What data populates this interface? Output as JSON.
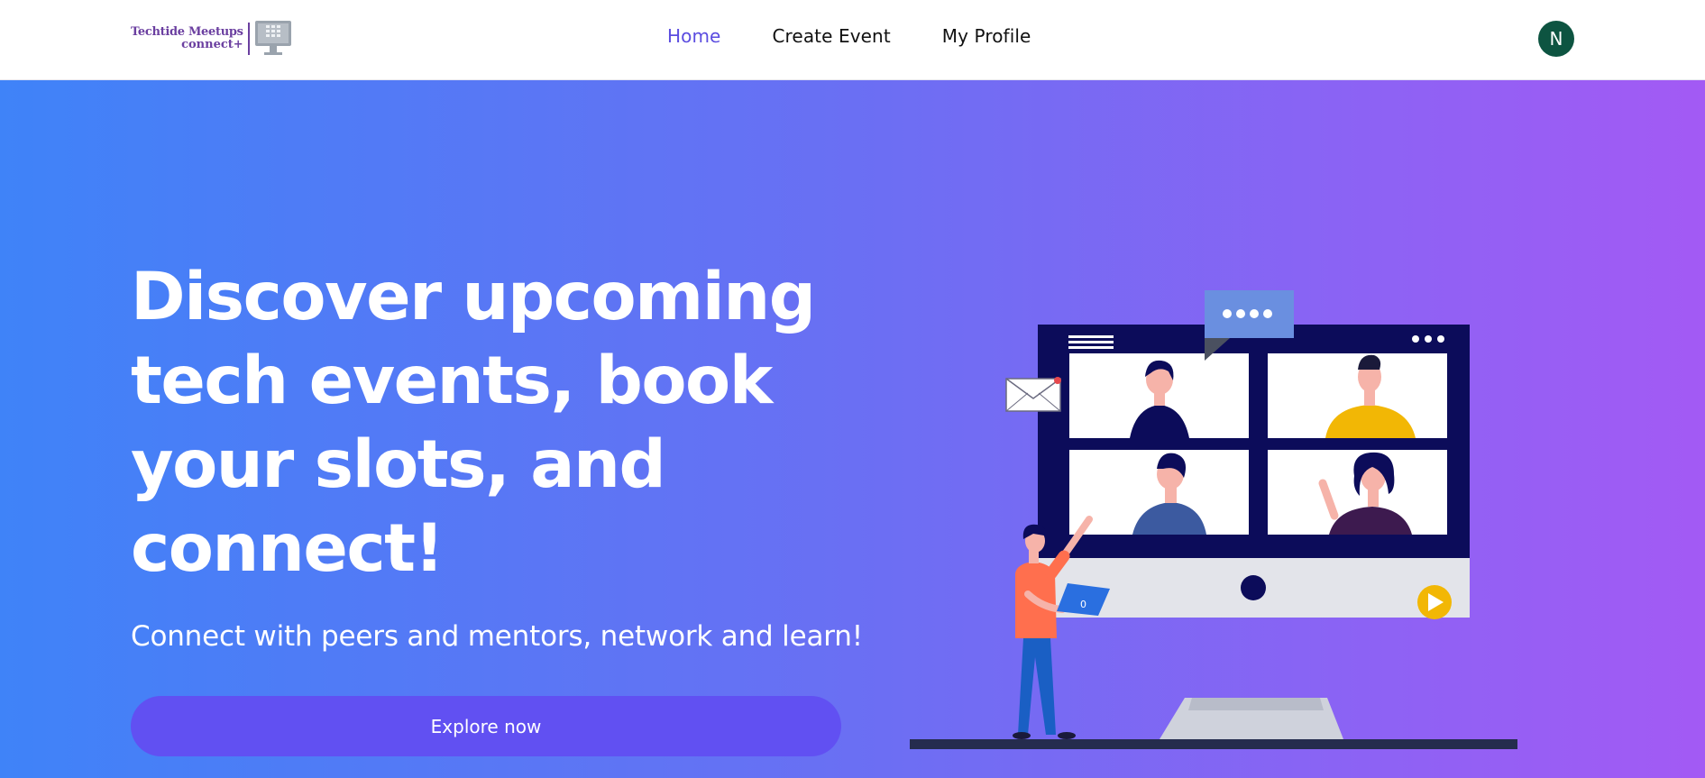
{
  "header": {
    "logo": {
      "line1": "Techtide Meetups",
      "line2": "connect+",
      "icon": "computer-monitor-icon"
    },
    "nav": [
      {
        "label": "Home",
        "active": true
      },
      {
        "label": "Create Event",
        "active": false
      },
      {
        "label": "My Profile",
        "active": false
      }
    ],
    "avatar_initial": "N"
  },
  "hero": {
    "headline": "Discover upcoming tech events, book your slots, and connect!",
    "subheadline": "Connect with peers and mentors, network and learn!",
    "cta_label": "Explore now",
    "illustration": "video-conference-illustration"
  },
  "colors": {
    "accent": "#5b4ce0",
    "cta": "#6150f2",
    "avatar": "#0d5441",
    "gradient_start": "#3f83f8",
    "gradient_end": "#a35af4"
  }
}
